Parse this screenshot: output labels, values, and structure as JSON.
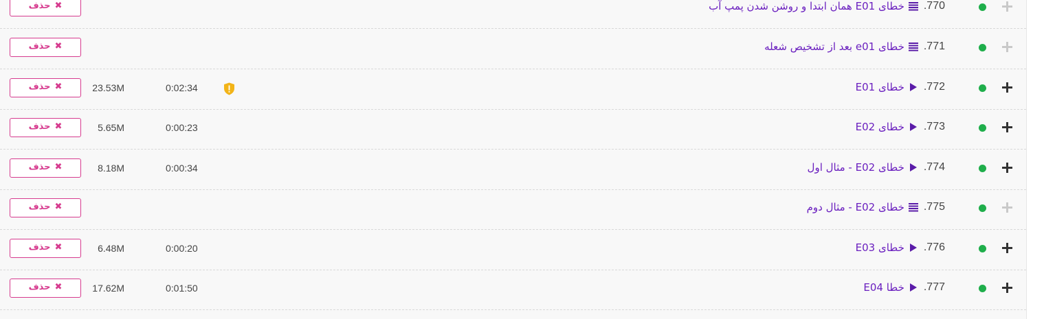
{
  "delete_label": "حذف",
  "colors": {
    "title": "#6a1fbf",
    "delete": "#d63a8e",
    "status_dot": "#1fae4b",
    "warning": "#f2b418"
  },
  "rows": [
    {
      "number": "770.",
      "icon": "list-icon",
      "title": "خطای E01 همان ابتدا و روشن شدن پمپ آب",
      "duration": "",
      "size": "",
      "warning": false,
      "expandable": false
    },
    {
      "number": "771.",
      "icon": "list-icon",
      "title": "خطای e01 بعد از تشخیص شعله",
      "duration": "",
      "size": "",
      "warning": false,
      "expandable": false
    },
    {
      "number": "772.",
      "icon": "play-icon",
      "title": "خطای E01",
      "duration": "0:02:34",
      "size": "23.53M",
      "warning": true,
      "expandable": true
    },
    {
      "number": "773.",
      "icon": "play-icon",
      "title": "خطای E02",
      "duration": "0:00:23",
      "size": "5.65M",
      "warning": false,
      "expandable": true
    },
    {
      "number": "774.",
      "icon": "play-icon",
      "title": "خطای E02 - مثال اول",
      "duration": "0:00:34",
      "size": "8.18M",
      "warning": false,
      "expandable": true
    },
    {
      "number": "775.",
      "icon": "list-icon",
      "title": "خطای E02 - مثال دوم",
      "duration": "",
      "size": "",
      "warning": false,
      "expandable": false
    },
    {
      "number": "776.",
      "icon": "play-icon",
      "title": "خطای E03",
      "duration": "0:00:20",
      "size": "6.48M",
      "warning": false,
      "expandable": true
    },
    {
      "number": "777.",
      "icon": "play-icon",
      "title": "خطا E04",
      "duration": "0:01:50",
      "size": "17.62M",
      "warning": false,
      "expandable": true
    }
  ]
}
